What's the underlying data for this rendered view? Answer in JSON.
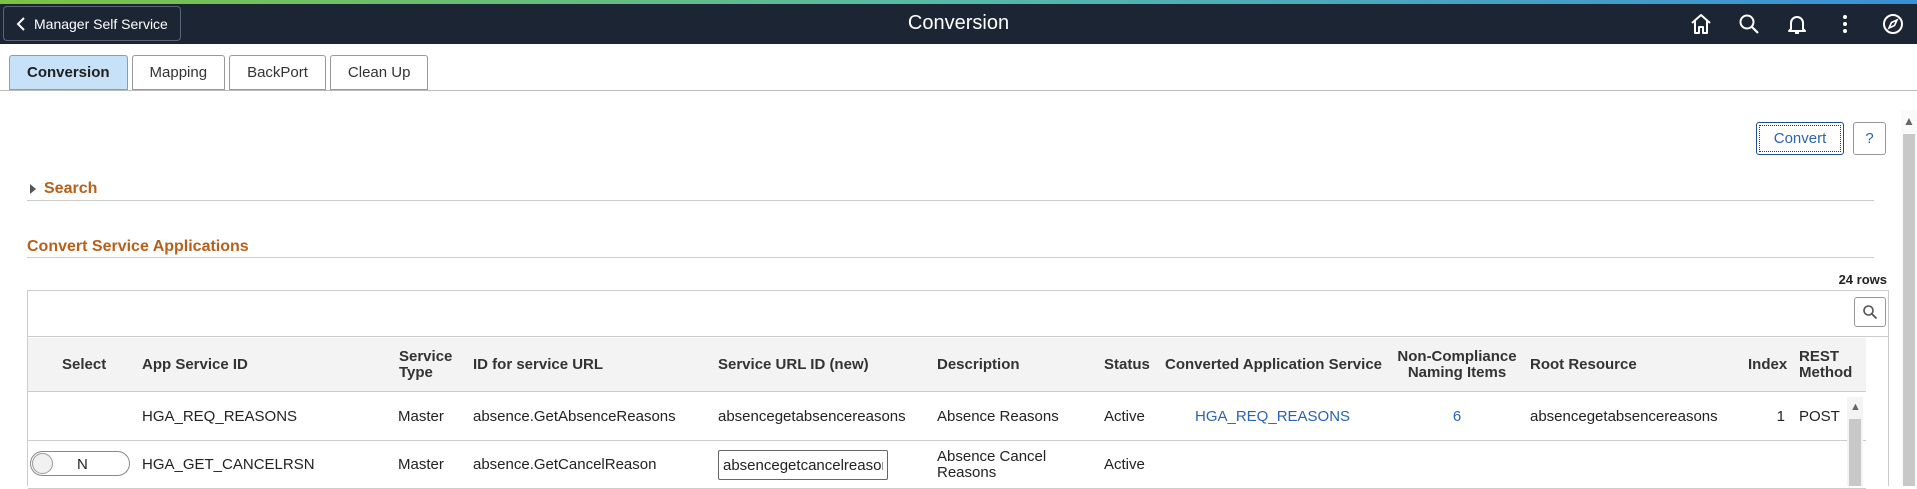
{
  "header": {
    "back_label": "Manager Self Service",
    "title": "Conversion",
    "icons": [
      "home-icon",
      "search-icon",
      "bell-icon",
      "more-vertical-icon",
      "navbar-icon"
    ]
  },
  "tabs": [
    {
      "label": "Conversion",
      "active": true
    },
    {
      "label": "Mapping",
      "active": false
    },
    {
      "label": "BackPort",
      "active": false
    },
    {
      "label": "Clean Up",
      "active": false
    }
  ],
  "actions": {
    "convert_label": "Convert",
    "help_label": "?"
  },
  "search_section": {
    "label": "Search"
  },
  "section_title": "Convert Service Applications",
  "grid": {
    "row_count": "24 rows",
    "columns": {
      "select": "Select",
      "app_service_id": "App Service ID",
      "service_type": "Service Type",
      "id_for_service_url": "ID for service URL",
      "service_url_id_new": "Service URL ID (new)",
      "description": "Description",
      "status": "Status",
      "converted_app_service": "Converted Application Service",
      "non_compliance": "Non-Compliance Naming Items",
      "root_resource": "Root Resource",
      "index": "Index",
      "rest_method": "REST Method"
    },
    "rows": [
      {
        "select": "",
        "app_service_id": "HGA_REQ_REASONS",
        "service_type": "Master",
        "id_for_service_url": "absence.GetAbsenceReasons",
        "service_url_id_new": "absencegetabsencereasons",
        "description": "Absence Reasons",
        "status": "Active",
        "converted_app_service": "HGA_REQ_REASONS",
        "non_compliance": "6",
        "root_resource": "absencegetabsencereasons",
        "index": "1",
        "rest_method": "POST"
      },
      {
        "select": "N",
        "app_service_id": "HGA_GET_CANCELRSN",
        "service_type": "Master",
        "id_for_service_url": "absence.GetCancelReason",
        "service_url_id_new": "absencegetcancelreason",
        "description": "Absence Cancel Reasons",
        "status": "Active",
        "converted_app_service": "",
        "non_compliance": "",
        "root_resource": "",
        "index": "",
        "rest_method": ""
      }
    ]
  }
}
